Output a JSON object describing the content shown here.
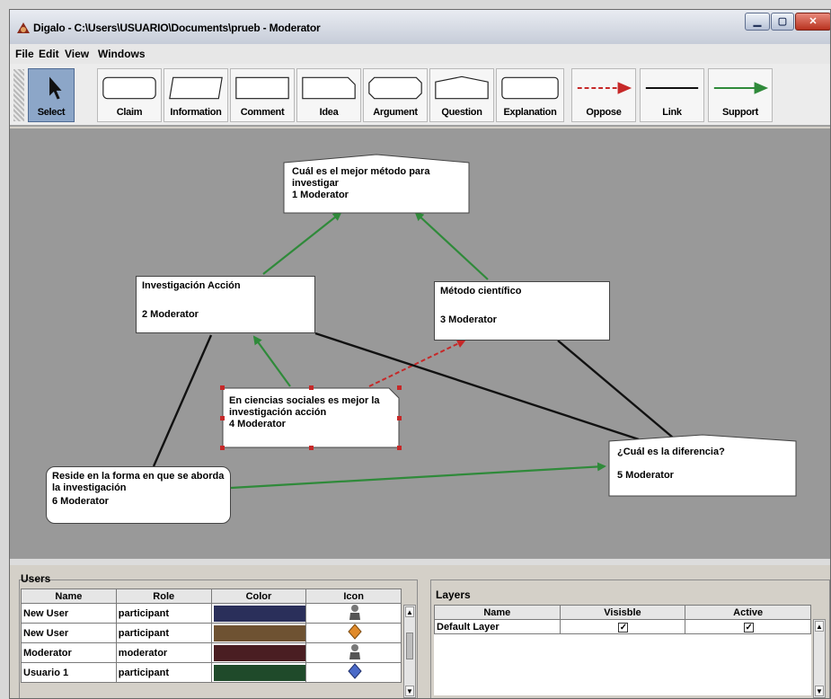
{
  "window": {
    "title": "Digalo - C:\\Users\\USUARIO\\Documents\\prueb - Moderator"
  },
  "menu": [
    "File",
    "Edit",
    "View",
    "Windows"
  ],
  "toolbar": [
    {
      "id": "select",
      "label": "Select",
      "icon": "arrow-cursor-icon",
      "selected": true
    },
    {
      "id": "claim",
      "label": "Claim",
      "icon": "rounded-rect-shape-icon"
    },
    {
      "id": "information",
      "label": "Information",
      "icon": "parallelogram-shape-icon"
    },
    {
      "id": "comment",
      "label": "Comment",
      "icon": "rectangle-shape-icon"
    },
    {
      "id": "idea",
      "label": "Idea",
      "icon": "cut-corner-shape-icon"
    },
    {
      "id": "argument",
      "label": "Argument",
      "icon": "octagon-shape-icon"
    },
    {
      "id": "question",
      "label": "Question",
      "icon": "pentagon-shape-icon"
    },
    {
      "id": "explanation",
      "label": "Explanation",
      "icon": "rounded-rect-shape-icon"
    },
    {
      "id": "oppose",
      "label": "Oppose",
      "icon": "dashed-red-arrow-icon"
    },
    {
      "id": "link",
      "label": "Link",
      "icon": "black-line-icon"
    },
    {
      "id": "support",
      "label": "Support",
      "icon": "green-arrow-icon"
    }
  ],
  "nodes": [
    {
      "id": "n1",
      "text": "Cuál es el mejor método para investigar",
      "user": "1 Moderator"
    },
    {
      "id": "n2",
      "text": "Investigación Acción",
      "user": "2 Moderator"
    },
    {
      "id": "n3",
      "text": "Método científico",
      "user": "3 Moderator"
    },
    {
      "id": "n4",
      "text": "En ciencias sociales es mejor la investigación acción",
      "user": "4 Moderator"
    },
    {
      "id": "n5",
      "text": "¿Cuál es la diferencia?",
      "user": "5 Moderator"
    },
    {
      "id": "n6",
      "text": "Reside en la forma en que se aborda la investigación",
      "user": "6 Moderator"
    }
  ],
  "links": [
    {
      "from": "n2",
      "to": "n1",
      "type": "support"
    },
    {
      "from": "n3",
      "to": "n1",
      "type": "support"
    },
    {
      "from": "n4",
      "to": "n2",
      "type": "support"
    },
    {
      "from": "n4",
      "to": "n3",
      "type": "oppose"
    },
    {
      "from": "n2",
      "to": "n5",
      "type": "link"
    },
    {
      "from": "n3",
      "to": "n5",
      "type": "link"
    },
    {
      "from": "n2",
      "to": "n6",
      "type": "link"
    },
    {
      "from": "n6",
      "to": "n5",
      "type": "support"
    }
  ],
  "users": {
    "title": "Users",
    "columns": [
      "Name",
      "Role",
      "Color",
      "Icon"
    ],
    "rows": [
      {
        "name": "New User",
        "role": "participant",
        "color": "#2a2f5a",
        "icon": "person-icon"
      },
      {
        "name": "New User",
        "role": "participant",
        "color": "#6e5232",
        "icon": "diamond-orange-icon"
      },
      {
        "name": "Moderator",
        "role": "moderator",
        "color": "#4a1e22",
        "icon": "person-icon"
      },
      {
        "name": "Usuario 1",
        "role": "participant",
        "color": "#1f4a2a",
        "icon": "diamond-blue-icon"
      }
    ]
  },
  "layers": {
    "title": "Layers",
    "columns": [
      "Name",
      "Visisble",
      "Active"
    ],
    "rows": [
      {
        "name": "Default Layer",
        "visible": true,
        "active": true
      }
    ]
  },
  "colors": {
    "support": "#2f8a3a",
    "oppose": "#c62828",
    "link": "#111111",
    "selected_tool": "#8ca6c8",
    "canvas": "#999999"
  }
}
